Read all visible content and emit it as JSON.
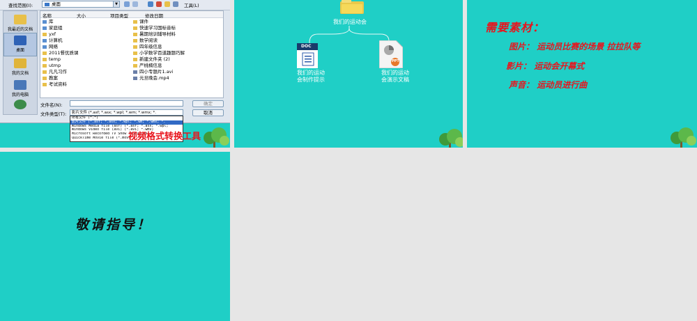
{
  "slide1": {
    "dialog": {
      "look_in_label": "查找范围(I):",
      "look_in_value": "桌面",
      "tools_label": "工具(L)",
      "places": [
        "我最近的文档",
        "桌面",
        "我的文档",
        "我的电脑",
        ""
      ],
      "columns": [
        "名称",
        "大小",
        "项目类型",
        "修改日期"
      ],
      "files_left": [
        "库",
        "家庭组",
        "yxf",
        "计算机",
        "网络",
        "2011餐优质课",
        "temp",
        "utmp",
        "凡凡习作",
        "教案",
        "考试资料"
      ],
      "files_right": [
        "课件",
        "快速学习国标音标",
        "暑期培训辅导材料",
        "数学阅读",
        "四年级信息",
        "小学数学百道趣题巧解",
        "新建文件夹 (2)",
        "严桃楠信息",
        "四小专题片1.avi",
        "元旦晚会.mp4"
      ],
      "filename_label": "文件名(N):",
      "filename_value": "",
      "filetype_label": "文件类型(T):",
      "filetype_value": "影片文件 (*.asf; *.asx; *.wpl; *.wm; *.wmx; *.",
      "ok_button": "确定",
      "cancel_button": "取消",
      "type_options": [
        "所有文件 (*.*)",
        "影片文件 (*.asf; *.asx; *.wpl; *.wm; *.wmx; *.",
        "Windows Media file (asf) (*.asf; *.asx; *.wpl;",
        "Windows video file (avi) (*.avi; *.wmv)",
        "Microsoft Recorded TV Show (*.dvr-ms)",
        "QuickTime Movie file (*.mov)"
      ]
    },
    "overlay_text": "视频格式转换工具"
  },
  "slide2": {
    "root": "我们的运动会",
    "doc_badge": "DOC",
    "ppt_badge": "PPT",
    "child_left": "我们的运动会制作提示",
    "child_right": "我们的运动会演示文稿"
  },
  "slide3": {
    "title": "需要素材：",
    "lines": [
      {
        "label": "图片：",
        "text": "运动员比赛的场景 拉拉队等"
      },
      {
        "label": "影片：",
        "text": "运动会开幕式"
      },
      {
        "label": "声音：",
        "text": "运动员进行曲"
      }
    ]
  },
  "slide4": {
    "text": "敬请指导！"
  },
  "colors": {
    "slide_bg": "#1fcfc6",
    "accent_red": "#e8141c",
    "page_bg": "#e6e6e6"
  }
}
